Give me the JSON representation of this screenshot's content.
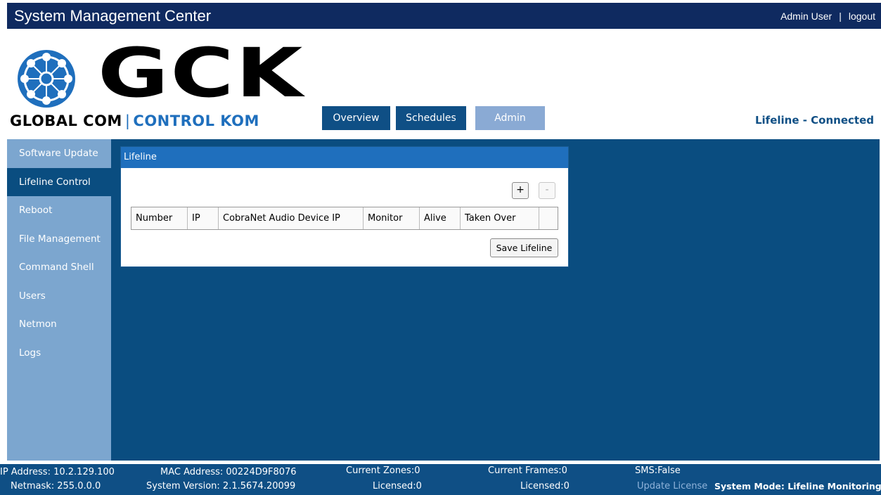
{
  "header": {
    "title": "System Management Center",
    "user": "Admin User",
    "separator": "|",
    "logout": "logout"
  },
  "logo": {
    "letters": "GCK",
    "tagline_left": "GLOBAL COM",
    "tagline_sep": "|",
    "tagline_right": "CONTROL KOM"
  },
  "nav": {
    "tabs": [
      {
        "label": "Overview"
      },
      {
        "label": "Schedules"
      },
      {
        "label": "Admin"
      }
    ],
    "status": "Lifeline - Connected"
  },
  "sidebar": {
    "items": [
      {
        "label": "Software Update"
      },
      {
        "label": "Lifeline Control"
      },
      {
        "label": "Reboot"
      },
      {
        "label": "File Management"
      },
      {
        "label": "Command Shell"
      },
      {
        "label": "Users"
      },
      {
        "label": "Netmon"
      },
      {
        "label": "Logs"
      }
    ]
  },
  "lifeline": {
    "title": "Lifeline",
    "add_label": "+",
    "remove_label": "-",
    "columns": [
      "Number",
      "IP",
      "CobraNet Audio Device IP",
      "Monitor",
      "Alive",
      "Taken Over",
      ""
    ],
    "save_label": "Save Lifeline"
  },
  "footer": {
    "ip": "IP Address: 10.2.129.100",
    "netmask": "Netmask: 255.0.0.0",
    "mac": "MAC Address: 00224D9F8076",
    "version": "System Version:  2.1.5674.20099",
    "zones": "Current Zones:0",
    "zones_licensed": "Licensed:0",
    "frames": "Current Frames:0",
    "frames_licensed": "Licensed:0",
    "sms": "SMS:False",
    "update_license": "Update License",
    "mode": "System Mode:  Lifeline Monitoring"
  },
  "colors": {
    "header_bg": "#0f2a60",
    "panel_bg": "#0a4d80",
    "sidebar_bg": "#7ca6cf",
    "accent": "#1f6fbd"
  }
}
